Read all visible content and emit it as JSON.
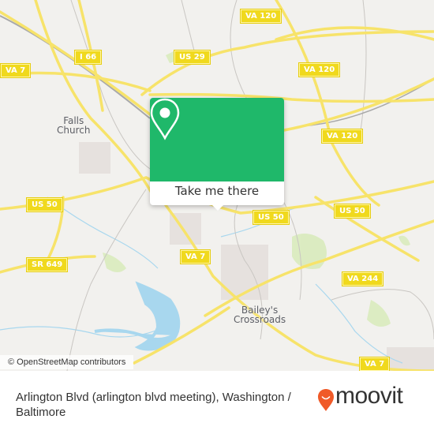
{
  "map": {
    "route_shields": [
      {
        "label": "VA 120",
        "id": "va-120-north"
      },
      {
        "label": "I 66",
        "id": "i-66"
      },
      {
        "label": "US 29",
        "id": "us-29"
      },
      {
        "label": "VA 7",
        "id": "va-7-west"
      },
      {
        "label": "VA 120",
        "id": "va-120-center"
      },
      {
        "label": "VA 120",
        "id": "va-120-east"
      },
      {
        "label": "US 50",
        "id": "us-50-west"
      },
      {
        "label": "US 50",
        "id": "us-50-center"
      },
      {
        "label": "US 50",
        "id": "us-50-east"
      },
      {
        "label": "SR 649",
        "id": "sr-649"
      },
      {
        "label": "VA 7",
        "id": "va-7-center"
      },
      {
        "label": "VA 244",
        "id": "va-244"
      },
      {
        "label": "VA 7",
        "id": "va-7-south"
      }
    ],
    "places": [
      {
        "label": "Falls\nChurch",
        "id": "falls-church"
      },
      {
        "label": "Bailey's\nCrossroads",
        "id": "baileys-crossroads"
      }
    ],
    "attribution": "© OpenStreetMap contributors",
    "colors": {
      "land": "#f2f1ee",
      "road": "#f7e36a",
      "water": "#a8d7ee",
      "park": "#d5eab5"
    }
  },
  "popup": {
    "icon": "map-pin-icon",
    "action_label": "Take me there",
    "accent": "#1fb86a"
  },
  "footer": {
    "title": "Arlington Blvd (arlington blvd meeting), Washington / Baltimore",
    "brand": "moovit",
    "brand_icon": "moovit-pin-icon",
    "brand_color": "#f05a28"
  }
}
